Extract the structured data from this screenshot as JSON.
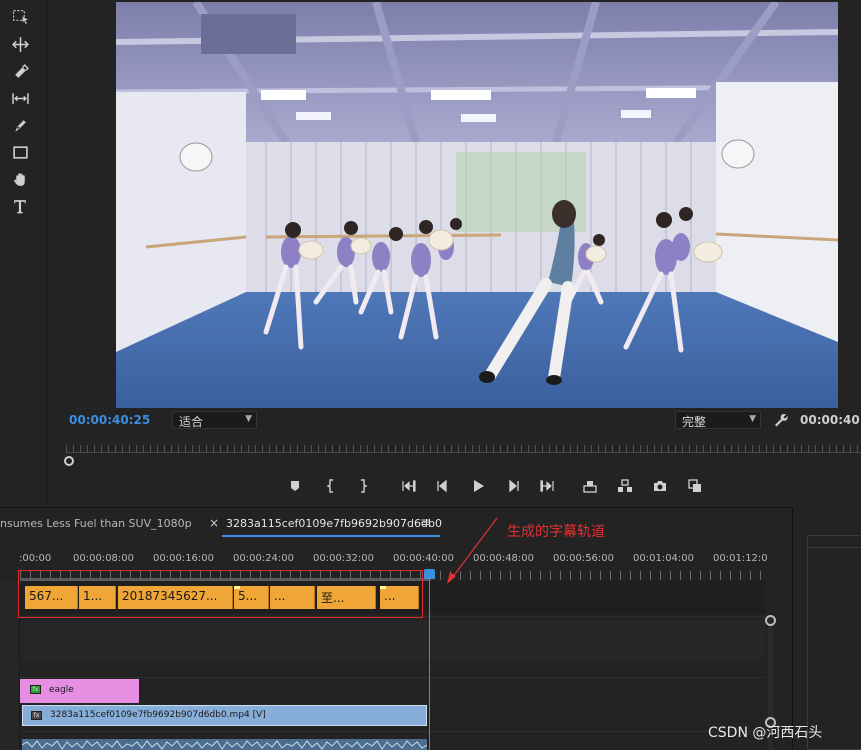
{
  "program_monitor": {
    "current_timecode": "00:00:40:25",
    "fit_dropdown": "适合",
    "quality_dropdown": "完整",
    "duration_timecode": "00:00:40:",
    "transport_buttons": [
      "add-marker",
      "mark-in",
      "mark-out",
      "go-to-in",
      "step-back",
      "play",
      "step-forward",
      "go-to-out",
      "lift",
      "extract",
      "export-frame",
      "button-editor"
    ]
  },
  "tools": [
    "marquee-select",
    "ripple-edit",
    "razor",
    "slip",
    "pen",
    "rectangle",
    "hand",
    "type"
  ],
  "timeline": {
    "tabs": [
      {
        "label": "nsumes Less Fuel than SUV_1080p",
        "active": false
      },
      {
        "label": "3283a115cef0109e7fb9692b907d6db0",
        "active": true
      }
    ],
    "tab_close": "×",
    "tab_menu": "≡",
    "ruler_labels": [
      ":00:00",
      "00:00:08:00",
      "00:00:16:00",
      "00:00:24:00",
      "00:00:32:00",
      "00:00:40:00",
      "00:00:48:00",
      "00:00:56:00",
      "00:01:04:00",
      "00:01:12:0"
    ],
    "caption_clips": [
      "567...",
      "1...",
      "20187345627...",
      "5...",
      "...",
      "至...",
      "..."
    ],
    "clips": {
      "graphic": {
        "fx": "fx",
        "label": "eagle"
      },
      "video": {
        "fx": "fx",
        "label": "3283a115cef0109e7fb9692b907d6db0.mp4 [V]"
      }
    }
  },
  "annotation": {
    "text": "生成的字幕轨道",
    "color": "#e53030"
  },
  "watermark": "CSDN @河西石头",
  "colors": {
    "accent_blue": "#3a8fe3",
    "caption_clip": "#f0a637",
    "graphic_clip": "#e58ee2",
    "video_clip": "#87aed8"
  }
}
